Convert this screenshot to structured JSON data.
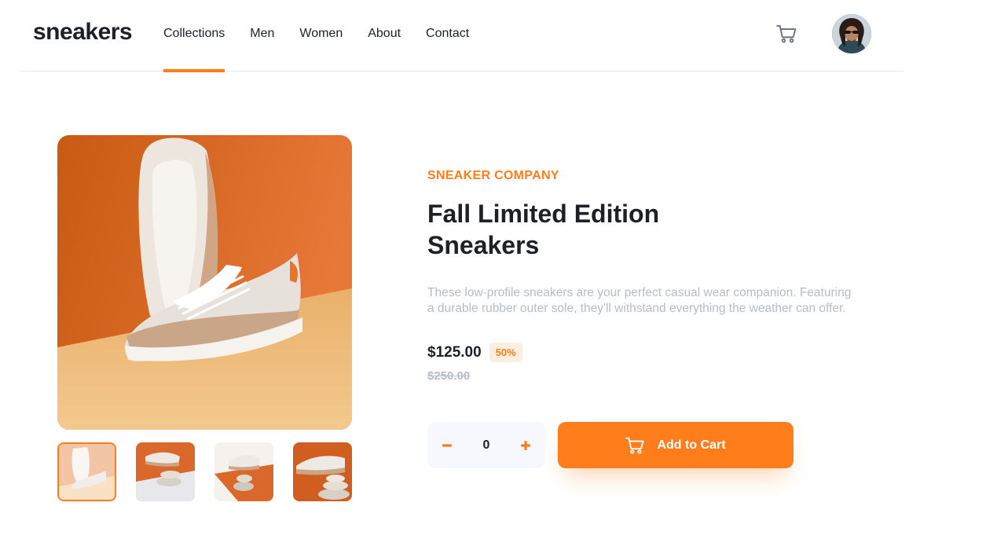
{
  "header": {
    "logo": "sneakers",
    "nav": [
      {
        "label": "Collections",
        "active": true
      },
      {
        "label": "Men",
        "active": false
      },
      {
        "label": "Women",
        "active": false
      },
      {
        "label": "About",
        "active": false
      },
      {
        "label": "Contact",
        "active": false
      }
    ],
    "cart_icon": "cart-icon",
    "avatar_icon": "avatar"
  },
  "gallery": {
    "main_image": "sneaker-product-photo",
    "thumbnails": [
      {
        "name": "thumbnail-1",
        "active": true
      },
      {
        "name": "thumbnail-2",
        "active": false
      },
      {
        "name": "thumbnail-3",
        "active": false
      },
      {
        "name": "thumbnail-4",
        "active": false
      }
    ]
  },
  "product": {
    "company": "SNEAKER COMPANY",
    "title_line1": "Fall Limited Edition",
    "title_line2": "Sneakers",
    "description": "These low-profile sneakers are your perfect casual wear companion. Featuring a durable rubber outer sole, they'll withstand everything the weather can offer.",
    "price": "$125.00",
    "discount": "50%",
    "old_price": "$250.00"
  },
  "cart": {
    "quantity": "0",
    "minus_icon": "minus-icon",
    "plus_icon": "plus-icon",
    "add_label": "Add to Cart"
  },
  "colors": {
    "accent": "#ff7e1b",
    "accent_light": "#ffede0",
    "text_dark": "#1d2026",
    "text_muted": "#b6bcc8",
    "bg_light": "#f7f8fd"
  }
}
